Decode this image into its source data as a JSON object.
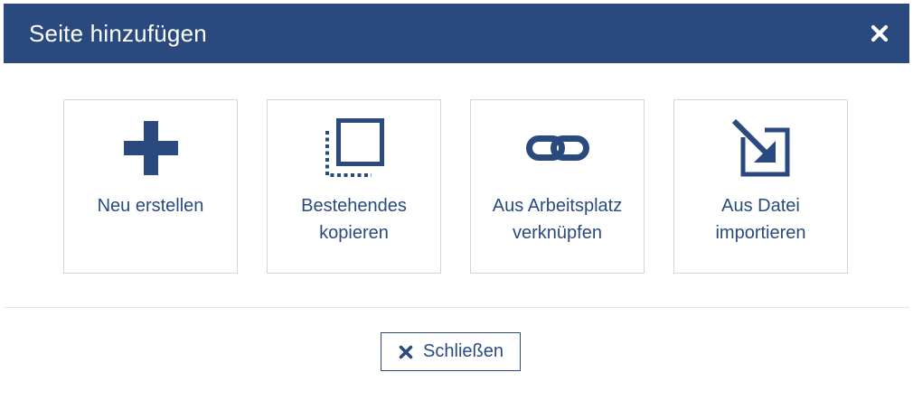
{
  "dialog": {
    "title": "Seite hinzufügen",
    "close_icon": "close-x-icon"
  },
  "options": [
    {
      "label": "Neu erstellen",
      "icon": "plus-icon"
    },
    {
      "label": "Bestehendes\nkopieren",
      "icon": "copy-icon"
    },
    {
      "label": "Aus Arbeitsplatz\nverknüpfen",
      "icon": "link-icon"
    },
    {
      "label": "Aus Datei\nimportieren",
      "icon": "import-icon"
    }
  ],
  "footer": {
    "close_label": "Schließen",
    "close_icon": "close-x-icon"
  },
  "colors": {
    "primary": "#2a4a7f",
    "border": "#d2d6dc",
    "background": "#ffffff"
  }
}
